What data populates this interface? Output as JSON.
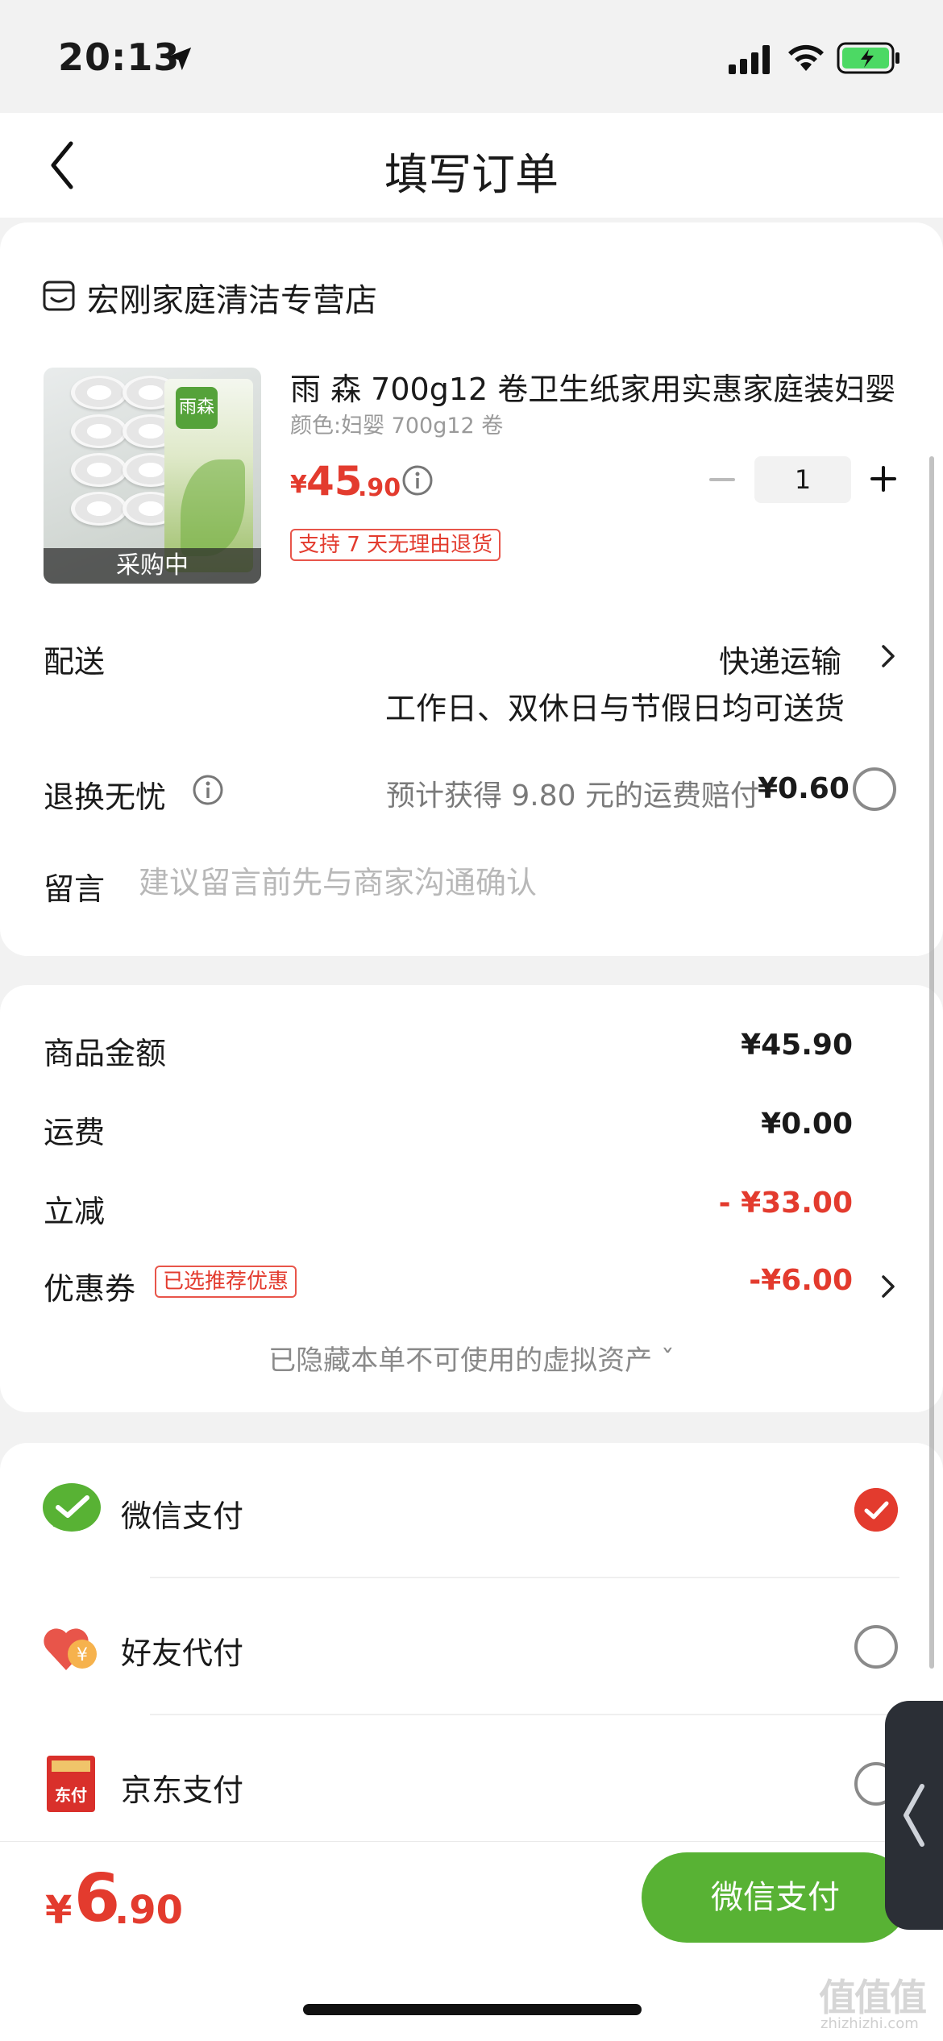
{
  "status_bar": {
    "time": "20:13"
  },
  "header": {
    "title": "填写订单"
  },
  "shop": {
    "name": "宏刚家庭清洁专营店"
  },
  "product": {
    "title": "雨 森 700g12 卷卫生纸家用实惠家庭装妇婴",
    "spec": "颜色:妇婴 700g12 卷",
    "price_symbol": "¥",
    "price_int": "45",
    "price_dec": ".90",
    "quantity": "1",
    "return_tag": "支持 7 天无理由退货",
    "image_banner": "采购中",
    "pack_logo": "雨森"
  },
  "delivery": {
    "label": "配送",
    "method": "快递运输",
    "note": "工作日、双休日与节假日均可送货"
  },
  "return_service": {
    "label": "退换无忧",
    "compensation": "预计获得 9.80 元的运费赔付",
    "price": "¥0.60"
  },
  "message": {
    "label": "留言",
    "placeholder": "建议留言前先与商家沟通确认"
  },
  "summary": {
    "goods_label": "商品金额",
    "goods_value": "¥45.90",
    "shipping_label": "运费",
    "shipping_value": "¥0.00",
    "discount_label": "立减",
    "discount_value": "- ¥33.00",
    "coupon_label": "优惠券",
    "coupon_tag": "已选推荐优惠",
    "coupon_value": "-¥6.00",
    "hidden_assets": "已隐藏本单不可使用的虚拟资产 ˇ"
  },
  "payment": {
    "options": [
      {
        "label": "微信支付",
        "selected": true
      },
      {
        "label": "好友代付",
        "selected": false
      },
      {
        "label": "京东支付",
        "selected": false
      }
    ],
    "jd_icon_text": "东付",
    "friend_icon_text": "¥"
  },
  "bottom": {
    "total_symbol": "¥",
    "total_int": "6",
    "total_dec": ".90",
    "pay_button": "微信支付"
  },
  "watermark": {
    "text": "值值值",
    "url": "zhizhizhi.com"
  },
  "colors": {
    "accent_red": "#e33b2e",
    "wechat_green": "#58b234"
  }
}
